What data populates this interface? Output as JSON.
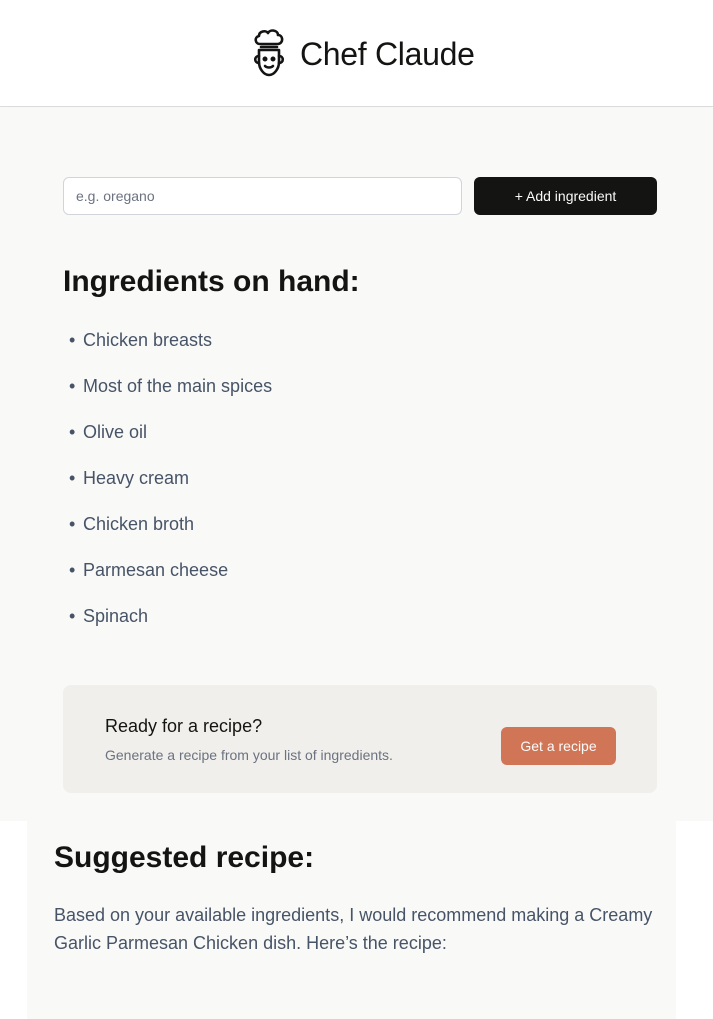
{
  "app": {
    "title": "Chef Claude",
    "logo_icon": "chef-hat-icon"
  },
  "form": {
    "input_placeholder": "e.g. oregano",
    "input_value": "",
    "add_button_label": "+ Add ingredient"
  },
  "ingredients": {
    "heading": "Ingredients on hand:",
    "bullet": "•",
    "items": [
      "Chicken breasts",
      "Most of the main spices",
      "Olive oil",
      "Heavy cream",
      "Chicken broth",
      "Parmesan cheese",
      "Spinach"
    ]
  },
  "cta": {
    "title": "Ready for a recipe?",
    "subtitle": "Generate a recipe from your list of ingredients.",
    "button_label": "Get a recipe"
  },
  "recipe": {
    "heading": "Suggested recipe:",
    "body": "Based on your available ingredients, I would recommend making a Creamy Garlic Parmesan Chicken dish. Here’s the recipe:"
  },
  "colors": {
    "primary_button": "#141413",
    "accent_button": "#d17557",
    "page_background": "#f9f9f7",
    "cta_background": "#f0efeb",
    "body_text": "#475467"
  }
}
